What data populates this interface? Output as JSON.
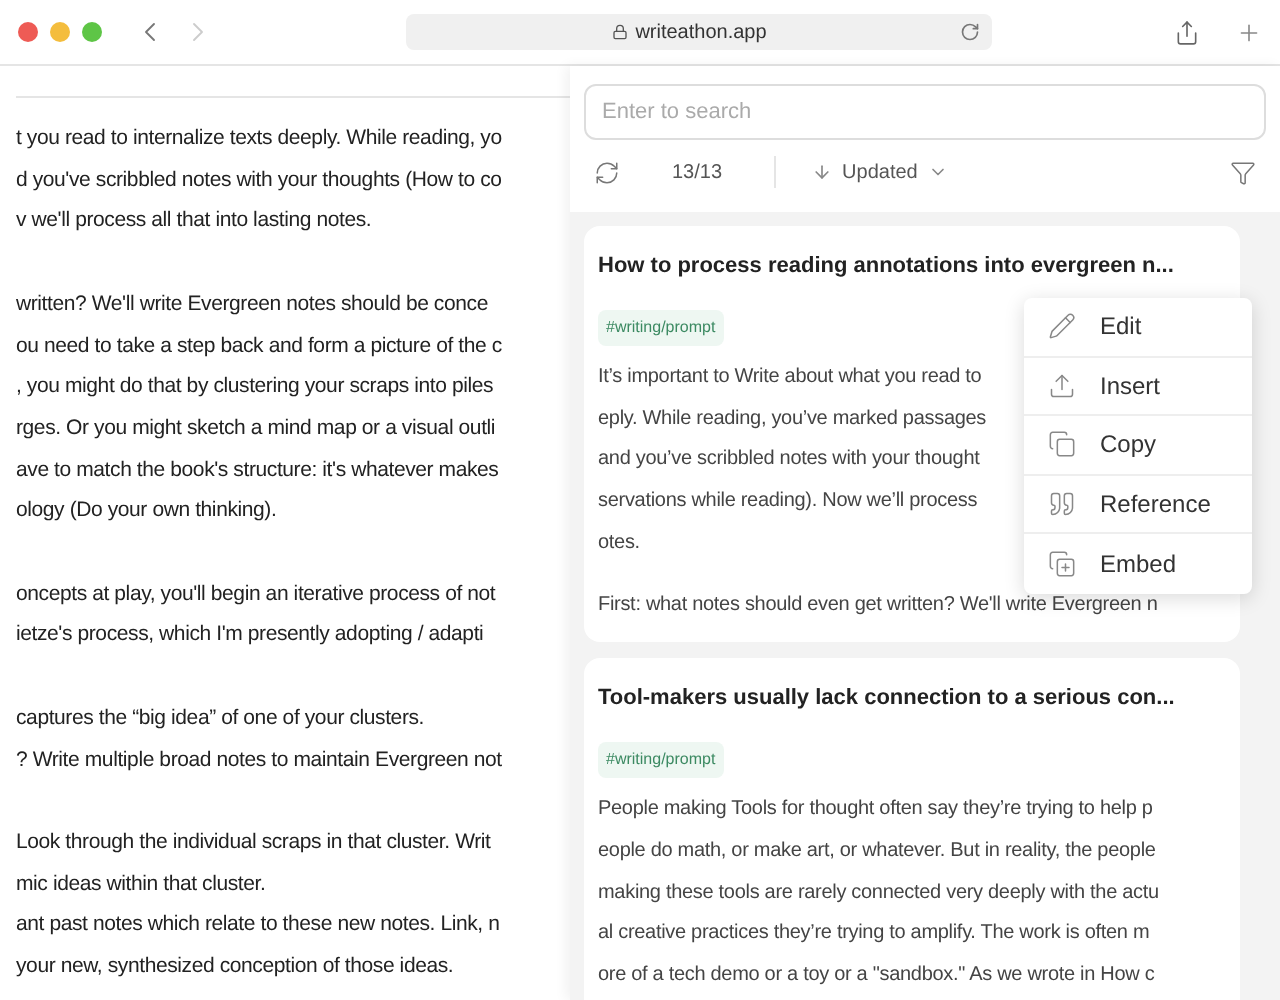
{
  "browser": {
    "url": "writeathon.app",
    "nav": [
      {
        "kind": "back",
        "disabled": false
      },
      {
        "kind": "forward",
        "disabled": true
      }
    ]
  },
  "document": {
    "paragraphs": [
      [
        "t you read to internalize texts deeply. While reading, yo",
        "d you've scribbled notes with your thoughts (How to co",
        "v we'll process all that into lasting notes."
      ],
      [
        "written? We'll write Evergreen notes should be conce",
        "ou need to take a step back and form a picture of the c",
        ", you might do that by clustering your scraps into piles",
        "rges. Or you might sketch a mind map or a visual outli",
        "ave to match the book's structure: it's whatever makes",
        "ology (Do your own thinking)."
      ],
      [
        "oncepts at play, you'll begin an iterative process of not",
        "ietze's process, which I'm presently adopting / adapti"
      ],
      [
        "captures the “big idea” of one of your clusters.",
        "? Write multiple broad notes to maintain Evergreen not"
      ],
      [
        "Look through the individual scraps in that cluster. Writ",
        "mic ideas within that cluster.",
        "ant past notes which relate to these new notes. Link, n",
        "your new, synthesized conception of those ideas."
      ]
    ]
  },
  "panel": {
    "search": {
      "placeholder": "Enter to search"
    },
    "count": "13/13",
    "sort": "Updated",
    "notes": [
      {
        "title": "How to process reading annotations into evergreen n...",
        "tag": "#writing/prompt",
        "lines": [
          "It’s important to Write about what you read to",
          "eply. While reading, you’ve marked passages",
          "and you’ve scribbled notes with your thought",
          "servations while reading). Now we’ll process",
          "otes.",
          "First: what notes should even get written? We'll write Evergreen n"
        ],
        "menu": [
          {
            "kind": "edit",
            "label": "Edit"
          },
          {
            "kind": "insert",
            "label": "Insert"
          },
          {
            "kind": "copy",
            "label": "Copy"
          },
          {
            "kind": "reference",
            "label": "Reference"
          },
          {
            "kind": "embed",
            "label": "Embed"
          }
        ]
      },
      {
        "title": "Tool-makers usually lack connection to a serious con...",
        "tag": "#writing/prompt",
        "lines": [
          "People making Tools for thought often say they’re trying to help p",
          "eople do math, or make art, or whatever. But in reality, the people",
          "making these tools are rarely connected very deeply with the actu",
          "al creative practices they’re trying to amplify. The work is often m",
          "ore of a tech demo or a toy or a \"sandbox.\" As we wrote in How c"
        ]
      }
    ]
  }
}
